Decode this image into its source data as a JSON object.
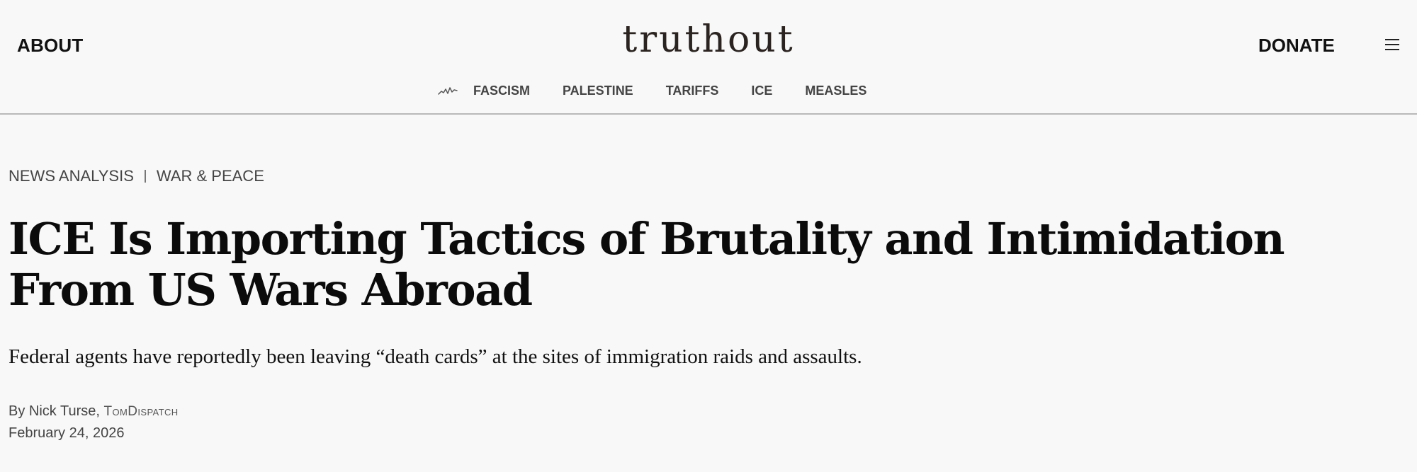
{
  "header": {
    "about_label": "ABOUT",
    "logo_text": "truthout",
    "donate_label": "DONATE",
    "menu_icon": "hamburger-menu-icon"
  },
  "nav": {
    "trending_icon": "trend-line-icon",
    "items": [
      {
        "label": "FASCISM"
      },
      {
        "label": "PALESTINE"
      },
      {
        "label": "TARIFFS"
      },
      {
        "label": "ICE"
      },
      {
        "label": "MEASLES"
      }
    ]
  },
  "article": {
    "breadcrumbs": [
      {
        "label": "NEWS ANALYSIS"
      },
      {
        "label": "WAR & PEACE"
      }
    ],
    "title": "ICE Is Importing Tactics of Brutality and Intimidation From US Wars Abroad",
    "dek": "Federal agents have reportedly been leaving “death cards” at the sites of immigration raids and assaults.",
    "byline_prefix": "By ",
    "author": "Nick Turse",
    "byline_sep": ", ",
    "source": "TomDispatch",
    "date": "February 24, 2026"
  },
  "colors": {
    "background": "#f8f8f8",
    "text": "#111111",
    "muted_text": "#444444",
    "divider": "#b9b9b9",
    "logo": "#2a2320"
  }
}
